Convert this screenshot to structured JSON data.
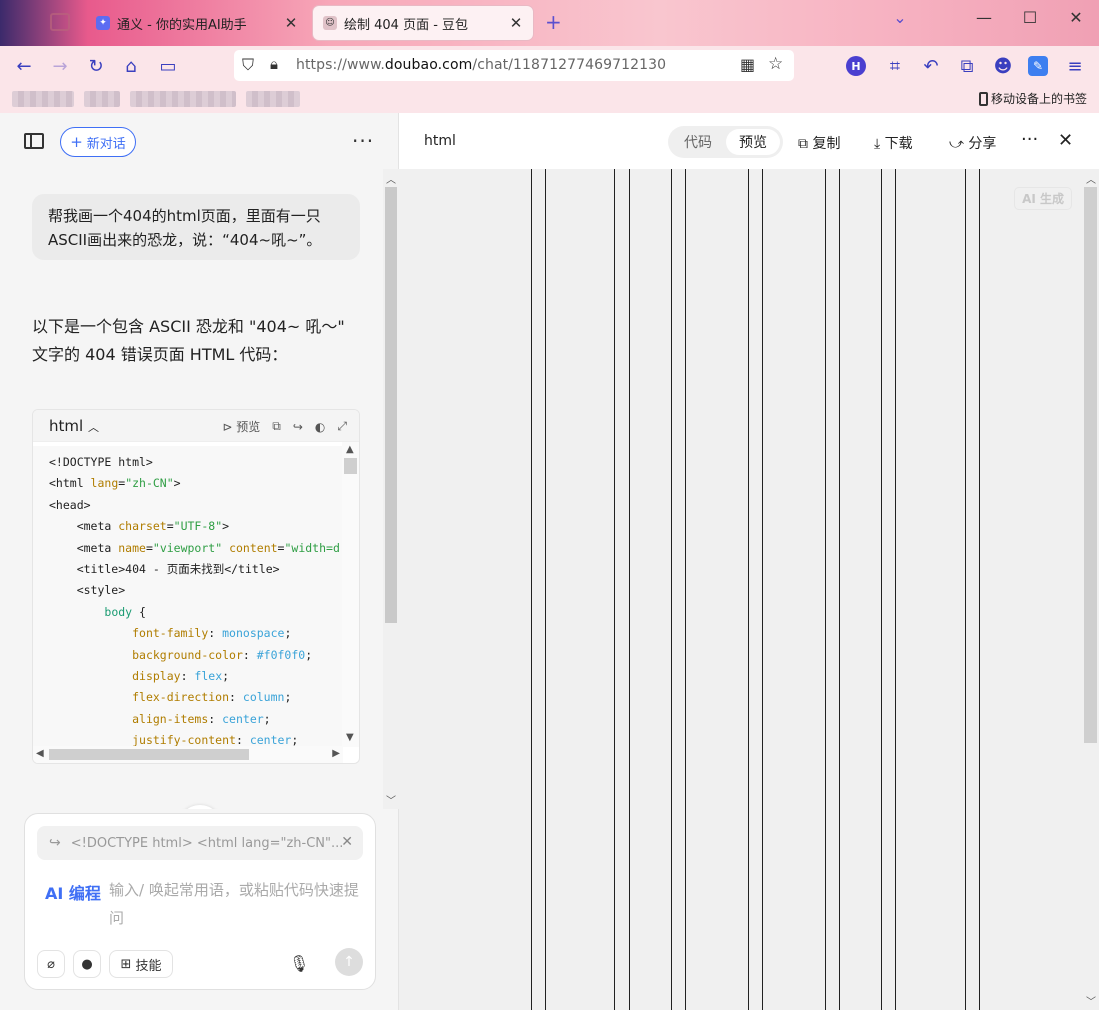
{
  "browser": {
    "tabs": [
      {
        "title": "通义 - 你的实用AI助手",
        "icon": "tongyi-icon"
      },
      {
        "title": "绘制 404 页面 - 豆包",
        "icon": "doubao-icon"
      }
    ],
    "url_prefix": "https://www.",
    "url_domain": "doubao.com",
    "url_path": "/chat/11871277469712130",
    "mobile_bookmarks": "移动设备上的书签"
  },
  "left": {
    "new_chat": "新对话",
    "user_message": "帮我画一个404的html页面，里面有一只ASCII画出来的恐龙，说：“404~吼~”。",
    "answer": "以下是一个包含 ASCII 恐龙和 \"404~ 吼～\" 文字的 404 错误页面 HTML 代码：",
    "code": {
      "lang": "html",
      "preview_label": "预览"
    },
    "composer": {
      "reference": "<!DOCTYPE html> <html lang=\"zh-CN\"...",
      "badge": "AI 编程",
      "placeholder": "输入/ 唤起常用语，或粘贴代码快速提问",
      "skills": "技能"
    }
  },
  "right": {
    "title": "html",
    "tabs": [
      "代码",
      "预览"
    ],
    "active_tab": "预览",
    "copy": "复制",
    "download": "下载",
    "share": "分享",
    "ai_badge": "AI 生成"
  },
  "colors": {
    "accent": "#3f6ff5",
    "preview_bg": "#f0f0f0"
  }
}
